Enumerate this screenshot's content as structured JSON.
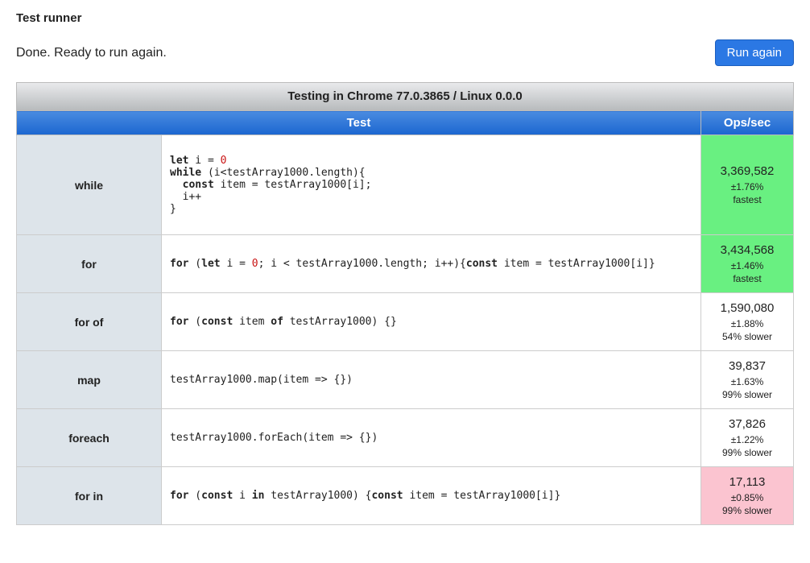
{
  "title": "Test runner",
  "status": "Done. Ready to run again.",
  "run_button": "Run again",
  "caption": "Testing in Chrome 77.0.3865 / Linux 0.0.0",
  "headers": {
    "test": "Test",
    "ops": "Ops/sec"
  },
  "rows": [
    {
      "label": "while",
      "code_tokens": [
        {
          "t": "let",
          "c": "kw"
        },
        {
          "t": " i = "
        },
        {
          "t": "0",
          "c": "num"
        },
        {
          "t": "\n"
        },
        {
          "t": "while",
          "c": "kw"
        },
        {
          "t": " (i<testArray1000.length){\n  "
        },
        {
          "t": "const",
          "c": "kw"
        },
        {
          "t": " item = testArray1000[i];\n  i++\n}"
        }
      ],
      "ops": "3,369,582",
      "margin": "±1.76%",
      "note": "fastest",
      "class": "fastest"
    },
    {
      "label": "for",
      "code_tokens": [
        {
          "t": "for",
          "c": "kw"
        },
        {
          "t": " ("
        },
        {
          "t": "let",
          "c": "kw"
        },
        {
          "t": " i = "
        },
        {
          "t": "0",
          "c": "num"
        },
        {
          "t": "; i < testArray1000.length; i++){"
        },
        {
          "t": "const",
          "c": "kw"
        },
        {
          "t": " item = testArray1000[i]}"
        }
      ],
      "ops": "3,434,568",
      "margin": "±1.46%",
      "note": "fastest",
      "class": "fastest"
    },
    {
      "label": "for of",
      "code_tokens": [
        {
          "t": "for",
          "c": "kw"
        },
        {
          "t": " ("
        },
        {
          "t": "const",
          "c": "kw"
        },
        {
          "t": " item "
        },
        {
          "t": "of",
          "c": "kw"
        },
        {
          "t": " testArray1000) {}"
        }
      ],
      "ops": "1,590,080",
      "margin": "±1.88%",
      "note": "54% slower",
      "class": ""
    },
    {
      "label": "map",
      "code_tokens": [
        {
          "t": "testArray1000.map(item => {})"
        }
      ],
      "ops": "39,837",
      "margin": "±1.63%",
      "note": "99% slower",
      "class": ""
    },
    {
      "label": "foreach",
      "code_tokens": [
        {
          "t": "testArray1000.forEach(item => {})"
        }
      ],
      "ops": "37,826",
      "margin": "±1.22%",
      "note": "99% slower",
      "class": ""
    },
    {
      "label": "for in",
      "code_tokens": [
        {
          "t": "for",
          "c": "kw"
        },
        {
          "t": " ("
        },
        {
          "t": "const",
          "c": "kw"
        },
        {
          "t": " i "
        },
        {
          "t": "in",
          "c": "kw"
        },
        {
          "t": " testArray1000) {"
        },
        {
          "t": "const",
          "c": "kw"
        },
        {
          "t": " item = testArray1000[i]}"
        }
      ],
      "ops": "17,113",
      "margin": "±0.85%",
      "note": "99% slower",
      "class": "slowest"
    }
  ]
}
